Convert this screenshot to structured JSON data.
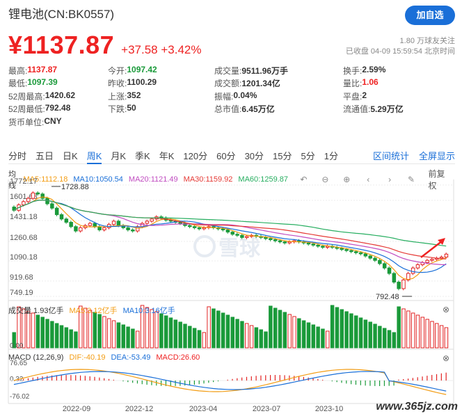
{
  "header": {
    "title": "锂电池(CN:BK0557)",
    "follow_label": "加自选",
    "price": "¥1137.87",
    "change": "+37.58 +3.42%",
    "followers": "1.80 万球友关注",
    "status": "已收盘 04-09 15:59:54 北京时间"
  },
  "stats": [
    [
      {
        "l": "最高:",
        "v": "1137.87",
        "c": "red"
      },
      {
        "l": "今开:",
        "v": "1097.42",
        "c": "green"
      },
      {
        "l": "成交量:",
        "v": "9511.96万手",
        "c": ""
      },
      {
        "l": "换手:",
        "v": "2.59%",
        "c": ""
      }
    ],
    [
      {
        "l": "最低:",
        "v": "1097.39",
        "c": "green"
      },
      {
        "l": "昨收:",
        "v": "1100.29",
        "c": ""
      },
      {
        "l": "成交额:",
        "v": "1201.34亿",
        "c": ""
      },
      {
        "l": "量比:",
        "v": "1.06",
        "c": "red"
      }
    ],
    [
      {
        "l": "52周最高:",
        "v": "1420.62",
        "c": ""
      },
      {
        "l": "上涨:",
        "v": "352",
        "c": ""
      },
      {
        "l": "振幅:",
        "v": "0.04%",
        "c": ""
      },
      {
        "l": "平盘:",
        "v": "2",
        "c": ""
      }
    ],
    [
      {
        "l": "52周最低:",
        "v": "792.48",
        "c": ""
      },
      {
        "l": "下跌:",
        "v": "50",
        "c": ""
      },
      {
        "l": "总市值:",
        "v": "6.45万亿",
        "c": ""
      },
      {
        "l": "流通值:",
        "v": "5.29万亿",
        "c": ""
      }
    ],
    [
      {
        "l": "货币单位:",
        "v": "CNY",
        "c": ""
      }
    ]
  ],
  "periods": [
    "分时",
    "五日",
    "日K",
    "周K",
    "月K",
    "季K",
    "年K",
    "120分",
    "60分",
    "30分",
    "15分",
    "5分",
    "1分"
  ],
  "active_period": "周K",
  "links": {
    "interval": "区间统计",
    "fullscreen": "全屏显示"
  },
  "ma": {
    "label": "均线",
    "ma5": "MA5:1112.18",
    "ma10": "MA10:1050.54",
    "ma20": "MA20:1121.49",
    "ma30": "MA30:1159.92",
    "ma60": "MA60:1259.87",
    "restore": "前复权"
  },
  "volume": {
    "label": "成交量 1.93亿手",
    "ma5": "MA5:3.12亿手",
    "ma10": "MA10:3.16亿手"
  },
  "macd": {
    "label": "MACD (12,26,9)",
    "dif": "DIF:-40.19",
    "dea": "DEA:-53.49",
    "macd": "MACD:26.60"
  },
  "watermark": "雪球",
  "site": "www.365jz.com",
  "colors": {
    "up": "#e22222",
    "down": "#1a9a3a",
    "accent": "#1a6fd8",
    "ma5": "#f39c12",
    "ma10": "#1a6fd8",
    "ma20": "#c04bc0",
    "ma30": "#e53935",
    "ma60": "#27ae60"
  },
  "chart_data": {
    "type": "candlestick",
    "y_ticks": [
      "1772.17",
      "1601.68",
      "1431.18",
      "1260.68",
      "1090.18",
      "919.68",
      "749.19"
    ],
    "high_label": "1728.88",
    "low_label": "792.48",
    "vol_ticks": [
      "0.00"
    ],
    "macd_ticks": [
      "76.65",
      "0.32",
      "-76.02"
    ],
    "x_labels": [
      "2022-09",
      "2022-12",
      "2023-04",
      "2023-07",
      "2023-10"
    ],
    "ylim": [
      749.19,
      1772.17
    ]
  }
}
